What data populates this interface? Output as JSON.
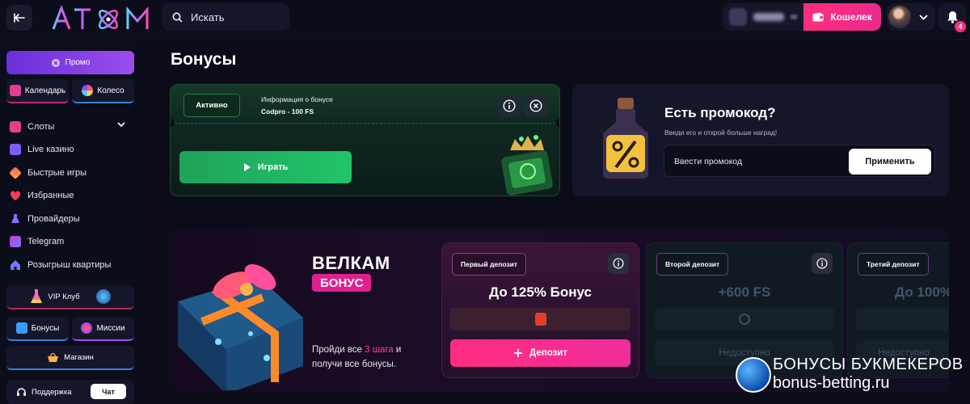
{
  "header": {
    "logo_text": "ATOM",
    "search_placeholder": "Искать",
    "wallet_label": "Кошелек",
    "notifications_count": "4"
  },
  "sidebar": {
    "promo_label": "Промо",
    "calendar_label": "Календарь",
    "wheel_label": "Колесо",
    "nav": [
      {
        "label": "Слоты",
        "icon": "slots-icon",
        "color": "#e0408f"
      },
      {
        "label": "Live казино",
        "icon": "live-casino-icon",
        "color": "#7a5cff"
      },
      {
        "label": "Быстрые игры",
        "icon": "rocket-icon",
        "color": "#ff5a5a"
      },
      {
        "label": "Избранные",
        "icon": "heart-icon",
        "color": "#ff3b5c"
      },
      {
        "label": "Провайдеры",
        "icon": "flask-icon",
        "color": "#8a6cff"
      },
      {
        "label": "Telegram",
        "icon": "telegram-icon",
        "color": "#c03fd8"
      },
      {
        "label": "Розыгрыш квартиры",
        "icon": "house-icon",
        "color": "#6f7cff"
      }
    ],
    "vip_label": "VIP Клуб",
    "bonuses_label": "Бонусы",
    "missions_label": "Миссии",
    "shop_label": "Магазин",
    "support_label": "Поддержка",
    "chat_label": "Чат"
  },
  "main": {
    "title": "Бонусы",
    "active_bonus": {
      "status": "Активно",
      "info_title": "Информация о бонусе",
      "info_value": "Codpro - 100 FS",
      "play_label": "Играть"
    },
    "promo": {
      "title": "Есть промокод?",
      "subtitle": "Введи его и открой больше наград!",
      "input_placeholder": "Ввести промокод",
      "apply_label": "Применить"
    },
    "welcome": {
      "title": "ВЕЛКАМ",
      "badge": "БОНУС",
      "desc_prefix": "Пройди все ",
      "desc_highlight": "3 шага",
      "desc_suffix": " и получи все бонусы."
    },
    "deposits": [
      {
        "label": "Первый депозит",
        "amount": "До 125% Бонус",
        "action": "Депозит"
      },
      {
        "label": "Второй депозит",
        "amount": "+600 FS",
        "action": "Недоступно"
      },
      {
        "label": "Третий депозит",
        "amount": "До 100%",
        "action": "Недоступно"
      }
    ]
  },
  "watermark": {
    "line1": "БОНУСЫ БУКМЕКЕРОВ",
    "line2": "bonus-betting.ru"
  },
  "colors": {
    "accent_pink": "#ff2d7f",
    "accent_green": "#21c46a",
    "accent_purple": "#9b4dee",
    "bg": "#0b0c17"
  }
}
